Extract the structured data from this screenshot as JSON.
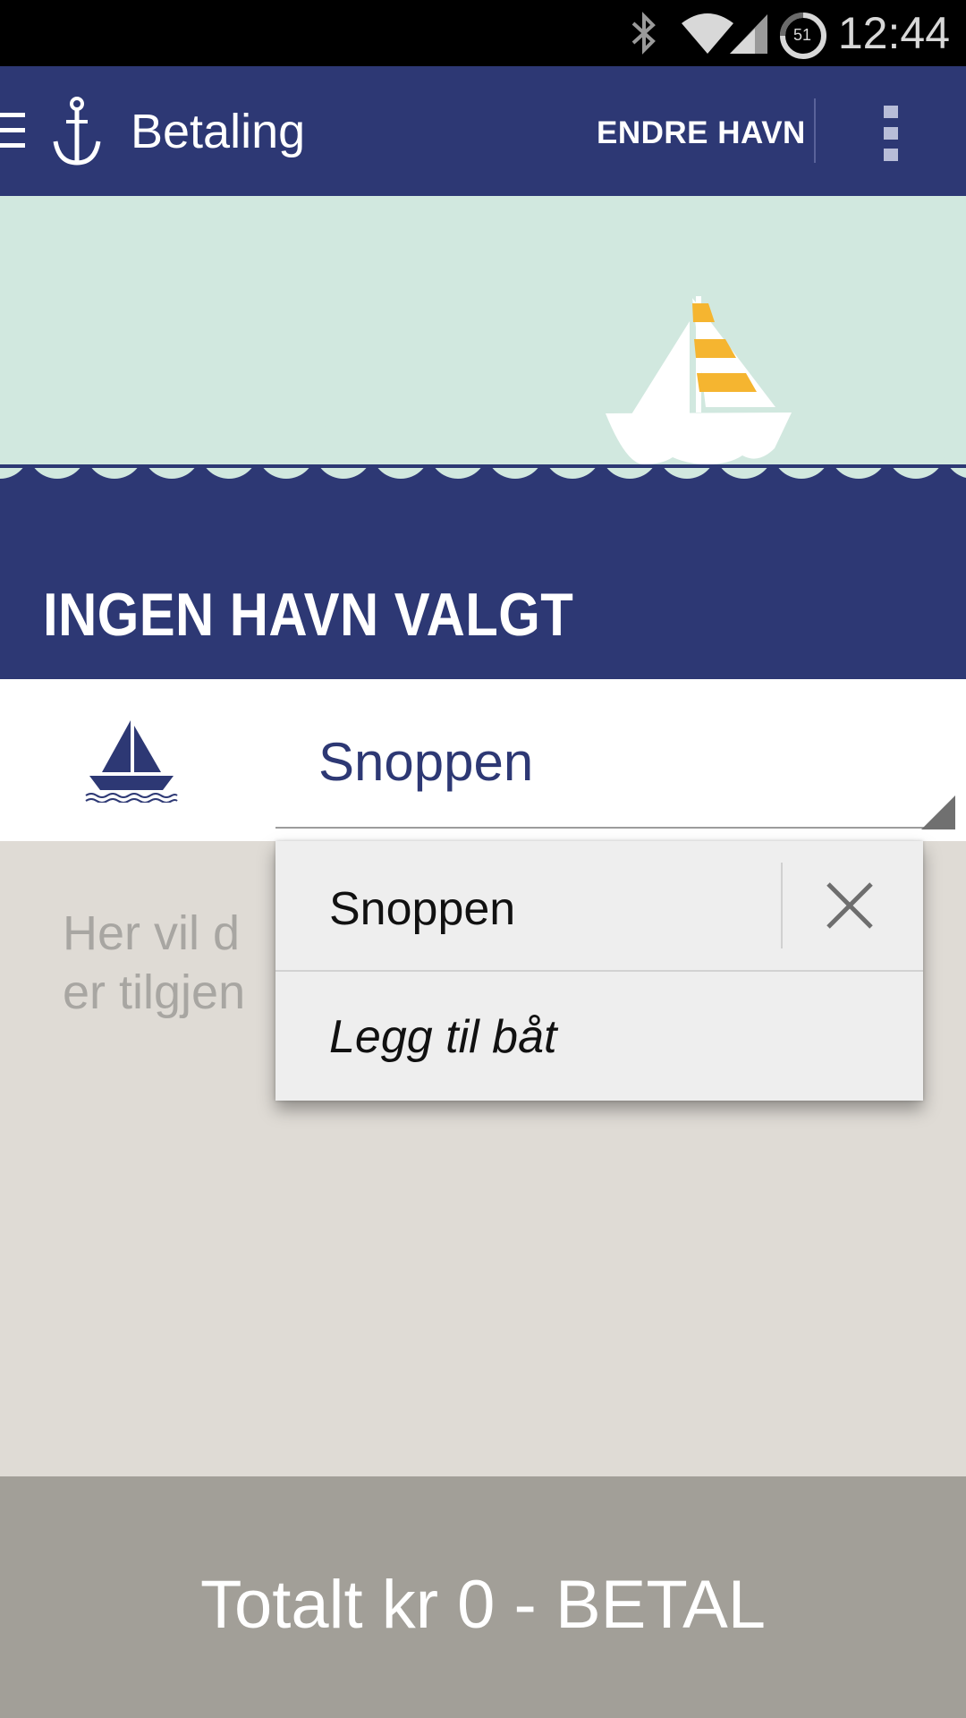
{
  "status_bar": {
    "time": "12:44",
    "battery_level": "51",
    "icons": [
      "bluetooth-icon",
      "wifi-icon",
      "signal-icon",
      "battery-icon"
    ]
  },
  "app_bar": {
    "title": "Betaling",
    "action_label": "ENDRE HAVN",
    "icons": [
      "menu-icon",
      "anchor-icon",
      "overflow-menu-icon"
    ]
  },
  "hero": {
    "title": "INGEN HAVN VALGT"
  },
  "boat_select": {
    "selected": "Snoppen"
  },
  "info": {
    "line1": "Her vil d",
    "line2": "er tilgjen"
  },
  "dropdown": {
    "options": [
      {
        "label": "Snoppen"
      },
      {
        "label": "Legg til båt"
      }
    ]
  },
  "footer": {
    "total_text": "Totalt kr 0 - ",
    "pay_label": "BETAL"
  },
  "colors": {
    "primary": "#2d3874",
    "sky": "#d1e8df",
    "sail_accent": "#f5b530",
    "footer": "#a29f98",
    "background": "#dfdbd5"
  }
}
